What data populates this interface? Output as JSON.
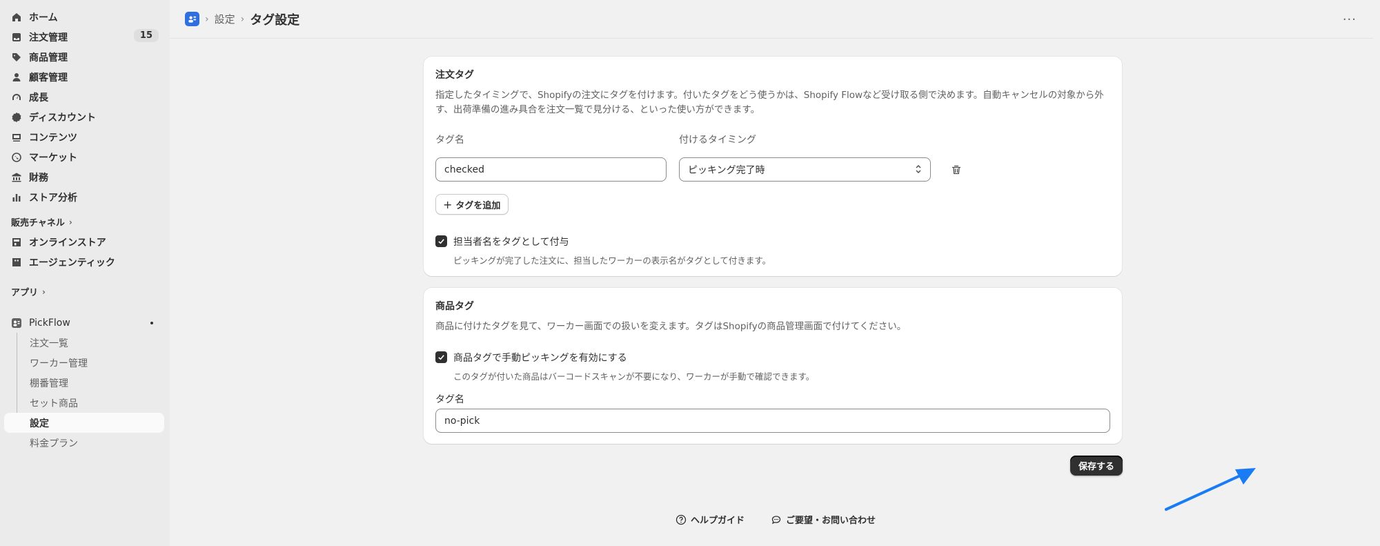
{
  "sidebar": {
    "nav": [
      {
        "label": "ホーム",
        "icon": "home-icon"
      },
      {
        "label": "注文管理",
        "icon": "inbox-icon",
        "badge": "15"
      },
      {
        "label": "商品管理",
        "icon": "tag-icon"
      },
      {
        "label": "顧客管理",
        "icon": "person-icon"
      },
      {
        "label": "成長",
        "icon": "gauge-icon"
      },
      {
        "label": "ディスカウント",
        "icon": "discount-icon"
      },
      {
        "label": "コンテンツ",
        "icon": "content-icon"
      },
      {
        "label": "マーケット",
        "icon": "globe-icon"
      },
      {
        "label": "財務",
        "icon": "bank-icon"
      },
      {
        "label": "ストア分析",
        "icon": "bar-chart-icon"
      }
    ],
    "sales_channels_label": "販売チャネル",
    "channels": [
      {
        "label": "オンラインストア",
        "icon": "store-icon"
      },
      {
        "label": "エージェンティック",
        "icon": "agentic-icon"
      }
    ],
    "apps_label": "アプリ",
    "app_name": "PickFlow",
    "app_subitems": [
      "注文一覧",
      "ワーカー管理",
      "棚番管理",
      "セット商品",
      "設定",
      "料金プラン"
    ],
    "active_subitem": "設定"
  },
  "header": {
    "breadcrumb_parent": "設定",
    "title": "タグ設定"
  },
  "order_tags": {
    "title": "注文タグ",
    "description": "指定したタイミングで、Shopifyの注文にタグを付けます。付いたタグをどう使うかは、Shopify Flowなど受け取る側で決めます。自動キャンセルの対象から外す、出荷準備の進み具合を注文一覧で見分ける、といった使い方ができます。",
    "col_tag_name": "タグ名",
    "col_timing": "付けるタイミング",
    "row": {
      "tag_value": "checked",
      "timing_value": "ピッキング完了時"
    },
    "add_tag_label": "タグを追加",
    "assignee_checkbox_label": "担当者名をタグとして付与",
    "assignee_checkbox_help": "ピッキングが完了した注文に、担当したワーカーの表示名がタグとして付きます。",
    "assignee_checked": true
  },
  "product_tags": {
    "title": "商品タグ",
    "description": "商品に付けたタグを見て、ワーカー画面での扱いを変えます。タグはShopifyの商品管理画面で付けてください。",
    "manual_checkbox_label": "商品タグで手動ピッキングを有効にする",
    "manual_checkbox_help": "このタグが付いた商品はバーコードスキャンが不要になり、ワーカーが手動で確認できます。",
    "manual_checked": true,
    "tag_name_label": "タグ名",
    "tag_name_value": "no-pick"
  },
  "save_label": "保存する",
  "footer": {
    "help_label": "ヘルプガイド",
    "contact_label": "ご要望・お問い合わせ"
  },
  "colors": {
    "sidebar_bg": "#ebebeb",
    "main_bg": "#f1f1f1",
    "primary_button": "#303030",
    "annotation_arrow": "#1a7cf5",
    "app_icon": "#2f6fe0"
  }
}
